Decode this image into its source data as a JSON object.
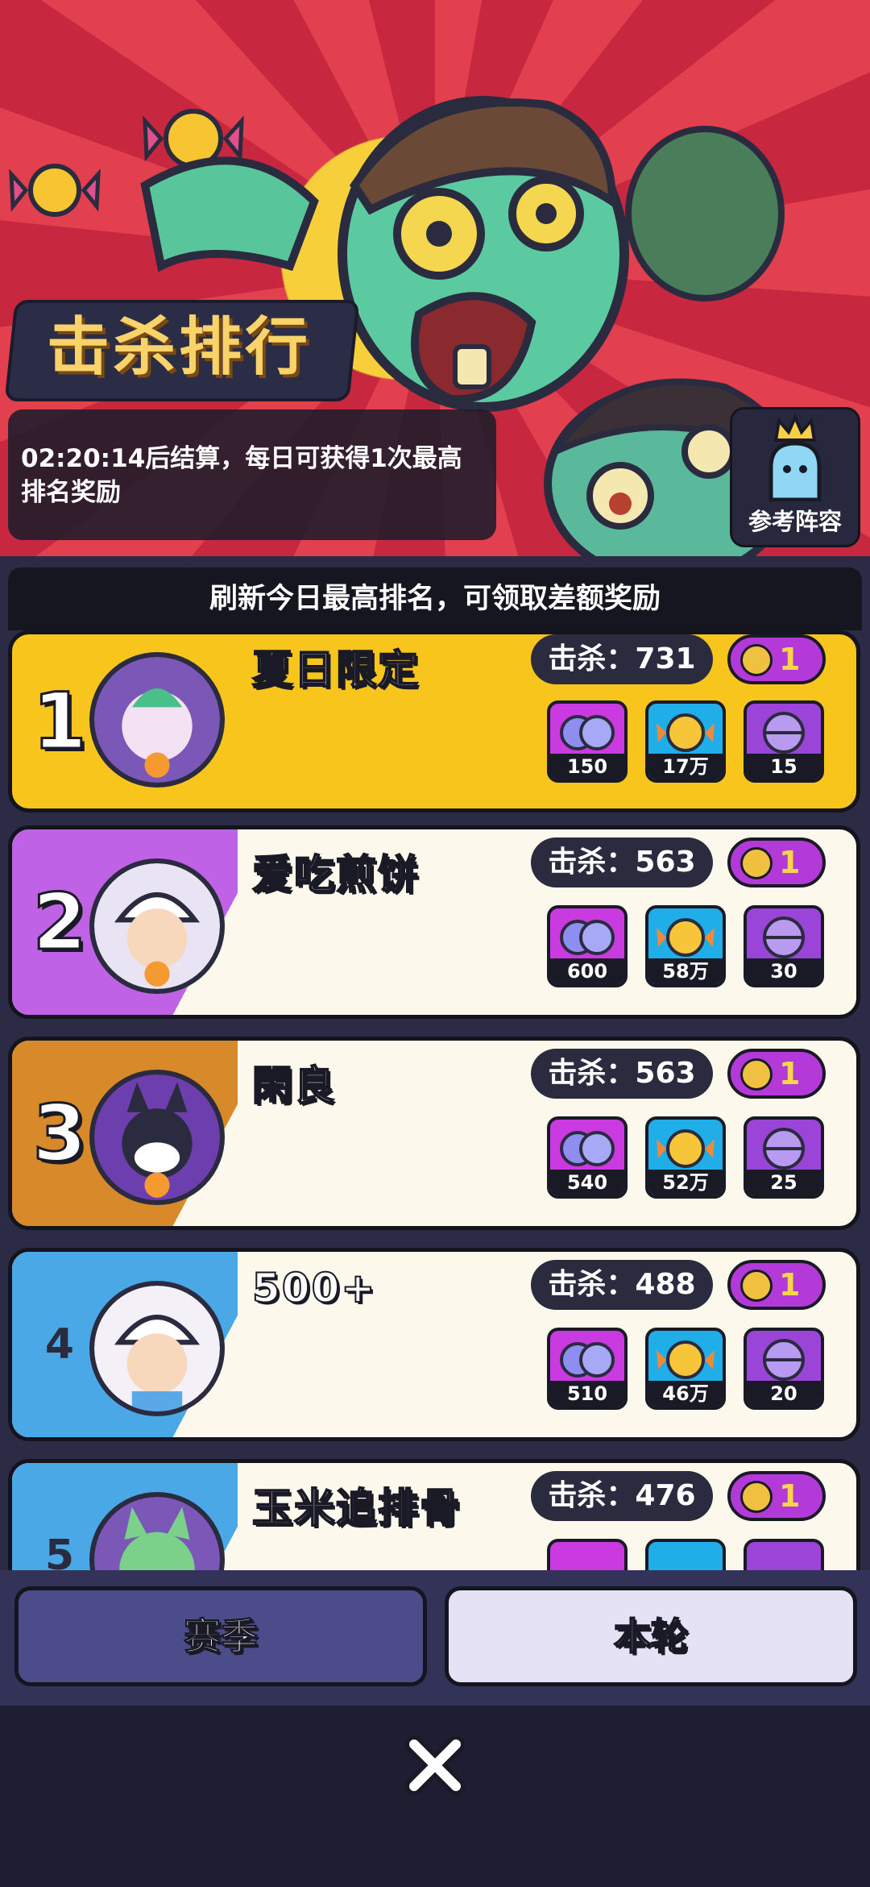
{
  "header": {
    "title": "击杀排行",
    "timer_text": "02:20:14后结算，每日可获得1次最高排名奖励",
    "reference_button": "参考阵容"
  },
  "notice": "刷新今日最高排名，可领取差额奖励",
  "kill_label": "击杀：",
  "players": [
    {
      "rank": "1",
      "name": "夏日限定",
      "kills": "击杀：731",
      "badge": "1",
      "rewards": [
        "150",
        "17万",
        "15"
      ],
      "theme": "#f8c51c"
    },
    {
      "rank": "2",
      "name": "爱吃煎饼",
      "kills": "击杀：563",
      "badge": "1",
      "rewards": [
        "600",
        "58万",
        "30"
      ],
      "theme": "#c062e6"
    },
    {
      "rank": "3",
      "name": "閑良",
      "kills": "击杀：563",
      "badge": "1",
      "rewards": [
        "540",
        "52万",
        "25"
      ],
      "theme": "#d88a2a"
    },
    {
      "rank": "4",
      "name": "500+",
      "kills": "击杀：488",
      "badge": "1",
      "rewards": [
        "510",
        "46万",
        "20"
      ],
      "theme": "#4aa8e6"
    },
    {
      "rank": "5",
      "name": "玉米追排骨",
      "kills": "击杀：476",
      "badge": "1",
      "rewards": [],
      "theme": "#4aa8e6"
    }
  ],
  "tabs": {
    "season": "赛季",
    "round": "本轮"
  },
  "icons": [
    "zombie-art",
    "candy-icon",
    "crown-icon",
    "ghost-icon",
    "skull-icon",
    "gem-icon",
    "coin-icon",
    "capsule-icon",
    "close-icon"
  ]
}
